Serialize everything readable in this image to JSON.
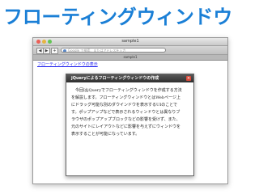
{
  "headline": "フローティングウィンドウ",
  "window": {
    "title": "sample1",
    "address_placeholder": "Google で検索、またはアドレスを入力",
    "tab_title": "sample1",
    "nav": {
      "back": "◀",
      "forward": "▶",
      "new_tab": "+"
    }
  },
  "page": {
    "link_text": "フローティングウィンドウの表示"
  },
  "dialog": {
    "title": "jQueryによるフローティングウィンドウの作成",
    "close_glyph": "×",
    "body_lines": [
      "　今回はjQueryでフローティングウィンドウを作成する方法",
      "を解説します。フローティングウィンドウとはWebページ上",
      "にドラッグ可能な別のダウインドウを表示するUIのことで",
      "す。ポップアップなどで表示されるウィンドウとは異なりブ",
      "ラウザのポップアップブロックなどの影響を受けず、また、",
      "元のサイトにレイアウトなどに影響を与えずにウィンドウを",
      "表示することが可能になっています。"
    ]
  },
  "colors": {
    "headline": "#1a7fd6",
    "link": "#1a1aee",
    "dialog_header": "#3a3a3a"
  }
}
